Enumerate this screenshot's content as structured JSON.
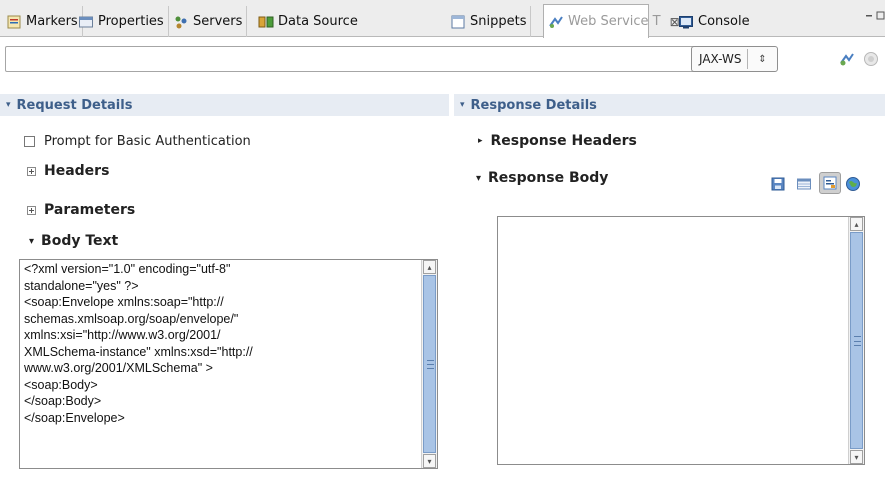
{
  "tabs": [
    {
      "label": "Markers",
      "icon": "markers-icon"
    },
    {
      "label": "Properties",
      "icon": "properties-icon"
    },
    {
      "label": "Servers",
      "icon": "servers-icon"
    },
    {
      "label": "Data Source",
      "icon": "data-source-icon"
    },
    {
      "label": "Snippets",
      "icon": "snippets-icon"
    },
    {
      "label": "Web Service T",
      "icon": "web-service-icon",
      "active": true,
      "close": "⊠"
    },
    {
      "label": "Console",
      "icon": "console-icon"
    }
  ],
  "toolbar": {
    "url_value": "",
    "dropdown_glyph": "⌵",
    "protocol": "JAX-WS",
    "spin_glyph": "⇕"
  },
  "request": {
    "header": "Request Details",
    "prompt_auth_label": "Prompt for Basic Authentication",
    "headers_label": "Headers",
    "parameters_label": "Parameters",
    "body_text_label": "Body Text",
    "body_lines": [
      "<?xml version=\"1.0\" encoding=\"utf-8\"",
      "standalone=\"yes\" ?>",
      "<soap:Envelope xmlns:soap=\"http://",
      "schemas.xmlsoap.org/soap/envelope/\"",
      "xmlns:xsi=\"http://www.w3.org/2001/",
      "XMLSchema-instance\" xmlns:xsd=\"http://",
      "www.w3.org/2001/XMLSchema\" >",
      "<soap:Body>",
      "</soap:Body>",
      "</soap:Envelope>"
    ]
  },
  "response": {
    "header": "Response Details",
    "response_headers_label": "Response Headers",
    "response_body_label": "Response Body",
    "body_text": ""
  },
  "colors": {
    "section_header_bg": "#e7ecf3",
    "section_header_text": "#3e5f8a",
    "scroll_thumb": "#a9c4e6"
  }
}
